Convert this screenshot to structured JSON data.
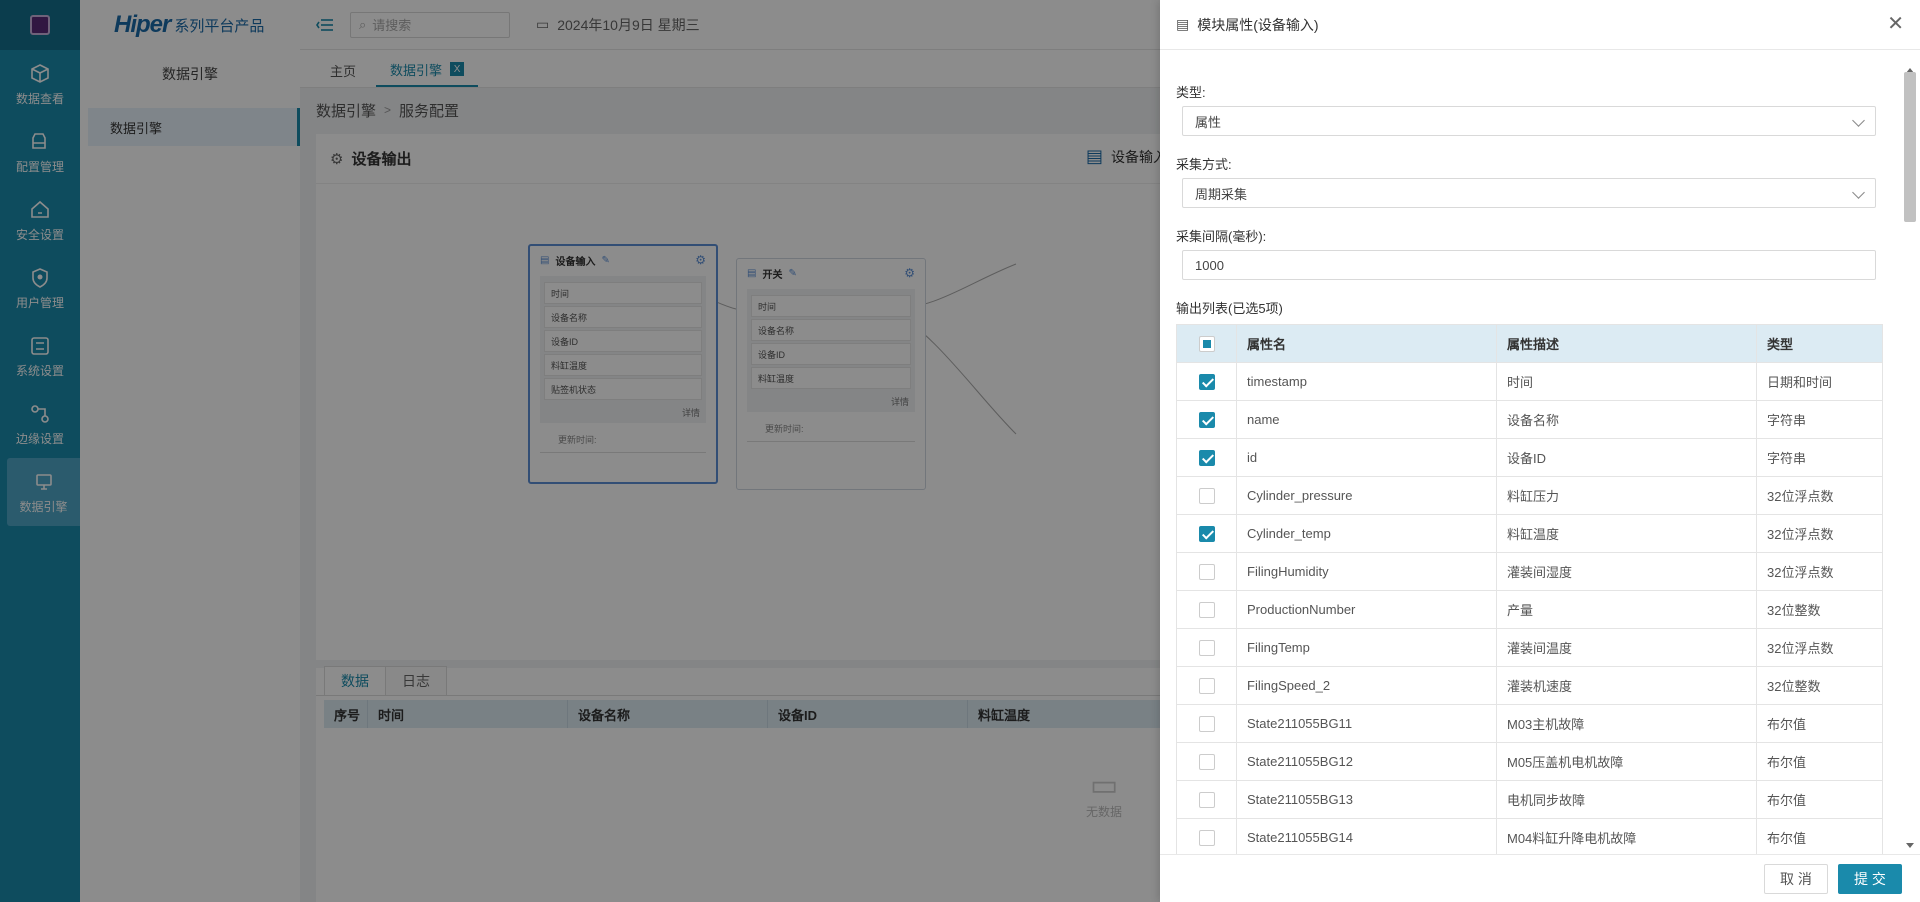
{
  "sidebar": {
    "items": [
      {
        "label": "数据查看",
        "icon": "cube-icon"
      },
      {
        "label": "配置管理",
        "icon": "printer-icon"
      },
      {
        "label": "安全设置",
        "icon": "lock-house-icon"
      },
      {
        "label": "用户管理",
        "icon": "shield-user-icon"
      },
      {
        "label": "系统设置",
        "icon": "sliders-icon"
      },
      {
        "label": "边缘设置",
        "icon": "network-icon"
      },
      {
        "label": "数据引擎",
        "icon": "engine-icon"
      }
    ]
  },
  "subnav": {
    "brand_main": "Hiper",
    "brand_suffix": "系列平台产品",
    "title": "数据引擎",
    "item": "数据引擎"
  },
  "topbar": {
    "search_placeholder": "请搜索",
    "date": "2024年10月9日 星期三"
  },
  "tabs": [
    {
      "label": "主页"
    },
    {
      "label": "数据引擎",
      "close": "X"
    }
  ],
  "breadcrumb": {
    "part1": "数据引擎",
    "sep": ">",
    "part2": "服务配置"
  },
  "panel": {
    "title": "设备输出",
    "right_label": "设备输入"
  },
  "nodes": {
    "input": {
      "title": "设备输入",
      "fields": [
        "时间",
        "设备名称",
        "设备ID",
        "料缸温度",
        "贴签机状态"
      ],
      "more": "详情",
      "footer": "更新时间:"
    },
    "switch": {
      "title": "开关",
      "fields": [
        "时间",
        "设备名称",
        "设备ID",
        "料缸温度"
      ],
      "more": "详情",
      "footer": "更新时间:"
    }
  },
  "data_tabs": {
    "tabs": [
      "数据",
      "日志"
    ],
    "columns": [
      "序号",
      "时间",
      "设备名称",
      "设备ID",
      "料缸温度"
    ],
    "empty": "无数据"
  },
  "drawer": {
    "title": "模块属性(设备输入)",
    "type_label": "类型:",
    "type_value": "属性",
    "method_label": "采集方式:",
    "method_value": "周期采集",
    "interval_label": "采集间隔(毫秒):",
    "interval_value": "1000",
    "list_label": "输出列表(已选5项)",
    "columns": [
      "属性名",
      "属性描述",
      "类型"
    ],
    "rows": [
      {
        "checked": true,
        "name": "timestamp",
        "desc": "时间",
        "type": "日期和时间"
      },
      {
        "checked": true,
        "name": "name",
        "desc": "设备名称",
        "type": "字符串"
      },
      {
        "checked": true,
        "name": "id",
        "desc": "设备ID",
        "type": "字符串"
      },
      {
        "checked": false,
        "name": "Cylinder_pressure",
        "desc": "料缸压力",
        "type": "32位浮点数"
      },
      {
        "checked": true,
        "name": "Cylinder_temp",
        "desc": "料缸温度",
        "type": "32位浮点数"
      },
      {
        "checked": false,
        "name": "FilingHumidity",
        "desc": "灌装间湿度",
        "type": "32位浮点数"
      },
      {
        "checked": false,
        "name": "ProductionNumber",
        "desc": "产量",
        "type": "32位整数"
      },
      {
        "checked": false,
        "name": "FilingTemp",
        "desc": "灌装间温度",
        "type": "32位浮点数"
      },
      {
        "checked": false,
        "name": "FilingSpeed_2",
        "desc": "灌装机速度",
        "type": "32位整数"
      },
      {
        "checked": false,
        "name": "State211055BG11",
        "desc": "M03主机故障",
        "type": "布尔值"
      },
      {
        "checked": false,
        "name": "State211055BG12",
        "desc": "M05压盖机电机故障",
        "type": "布尔值"
      },
      {
        "checked": false,
        "name": "State211055BG13",
        "desc": "电机同步故障",
        "type": "布尔值"
      },
      {
        "checked": false,
        "name": "State211055BG14",
        "desc": "M04料缸升降电机故障",
        "type": "布尔值"
      }
    ],
    "cancel": "取 消",
    "submit": "提 交"
  },
  "colors": {
    "accent": "#1a8aab",
    "rail": "#1a8aab",
    "header": "#dcebf3"
  }
}
